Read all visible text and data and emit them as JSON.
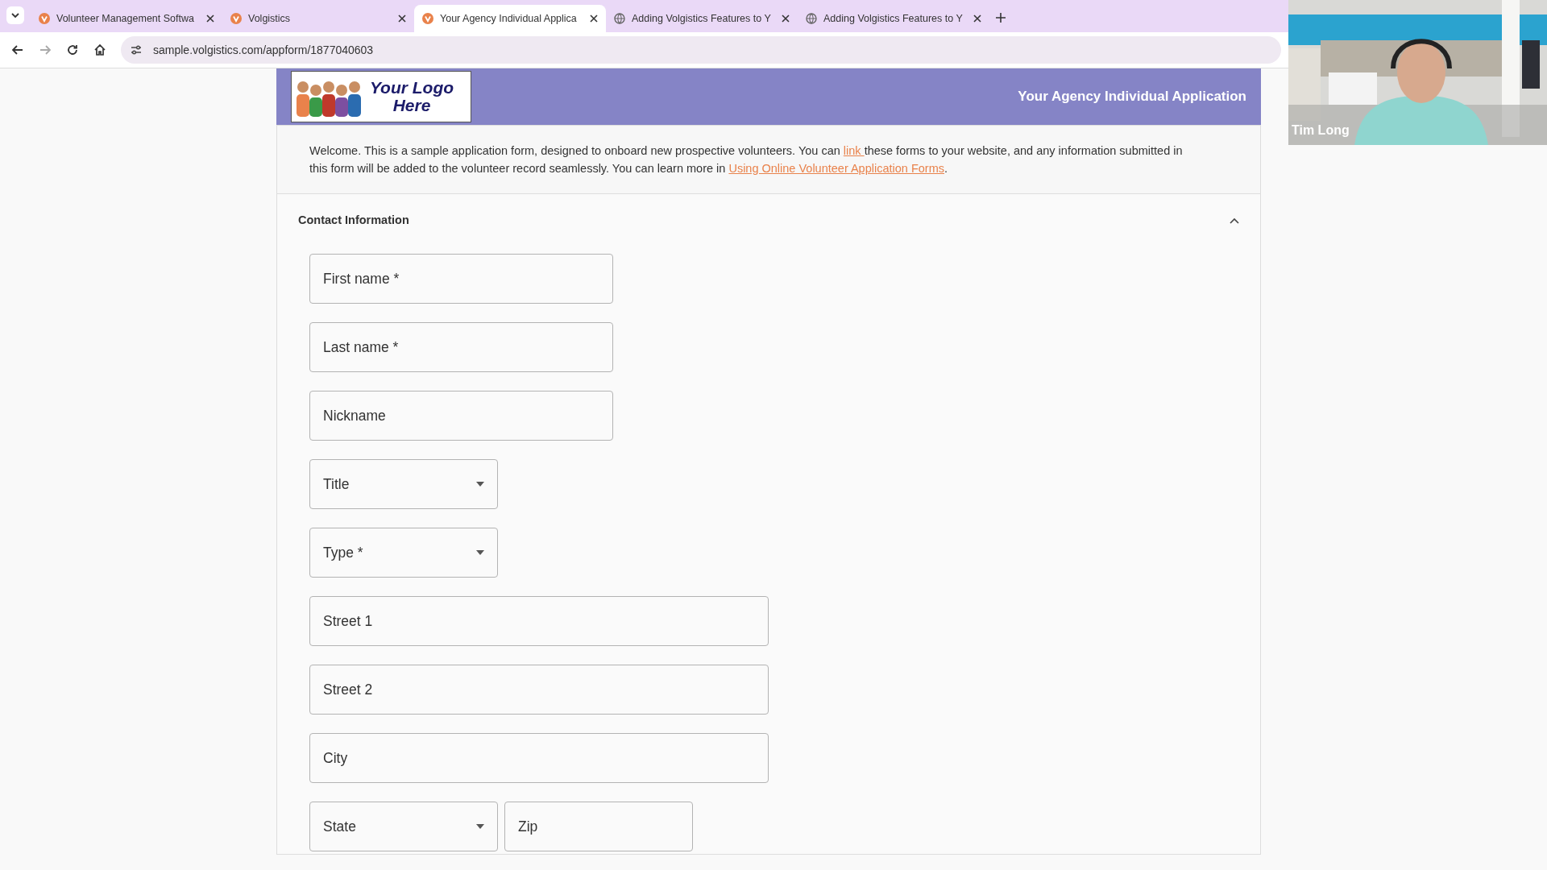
{
  "browser": {
    "tabs": [
      {
        "title": "Volunteer Management Softwa",
        "selected": false
      },
      {
        "title": "Volgistics",
        "selected": false
      },
      {
        "title": "Your Agency Individual Applica",
        "selected": true
      },
      {
        "title": "Adding Volgistics Features to Y",
        "selected": false
      },
      {
        "title": "Adding Volgistics Features to Y",
        "selected": false
      }
    ],
    "url": "sample.volgistics.com/appform/1877040603"
  },
  "header": {
    "logo_text": "Your Logo Here",
    "title": "Your Agency Individual Application"
  },
  "welcome": [
    {
      "kind": "text",
      "text": "Welcome. This is a sample application form, designed to onboard new prospective volunteers. You can "
    },
    {
      "kind": "link",
      "text": "link "
    },
    {
      "kind": "text",
      "text": "these forms to your website, and any information submitted in this form will be added to the volunteer record seamlessly. You can learn more in "
    },
    {
      "kind": "link",
      "text": "Using Online Volunteer Application Forms"
    },
    {
      "kind": "text",
      "text": "."
    }
  ],
  "section": {
    "title": "Contact Information",
    "expanded": true,
    "rows": [
      [
        {
          "kind": "text",
          "label": "First name *"
        }
      ],
      [
        {
          "kind": "text",
          "label": "Last name *"
        }
      ],
      [
        {
          "kind": "text",
          "label": "Nickname"
        }
      ],
      [
        {
          "kind": "select",
          "label": "Title"
        }
      ],
      [
        {
          "kind": "select",
          "label": "Type *"
        }
      ],
      [
        {
          "kind": "text",
          "label": "Street 1"
        }
      ],
      [
        {
          "kind": "text",
          "label": "Street 2"
        }
      ],
      [
        {
          "kind": "text",
          "label": "City"
        }
      ],
      [
        {
          "kind": "select",
          "label": "State"
        },
        {
          "kind": "text",
          "label": "Zip"
        }
      ]
    ]
  },
  "video": {
    "kind": "picture",
    "caption": "Tim Long"
  }
}
